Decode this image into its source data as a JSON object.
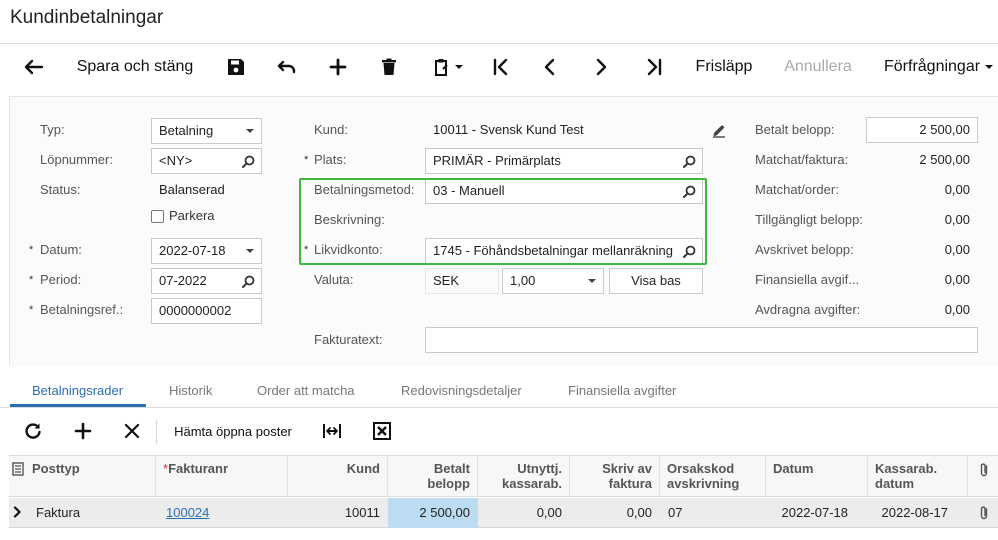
{
  "page": {
    "title": "Kundinbetalningar"
  },
  "toolbar": {
    "save_close": "Spara och stäng",
    "release": "Frisläpp",
    "cancel": "Annullera",
    "inquiries": "Förfrågningar"
  },
  "form": {
    "typ_label": "Typ:",
    "typ_value": "Betalning",
    "lopnummer_label": "Löpnummer:",
    "lopnummer_value": "<NY>",
    "status_label": "Status:",
    "status_value": "Balanserad",
    "parkera_label": "Parkera",
    "datum_label": "Datum:",
    "datum_value": "2022-07-18",
    "period_label": "Period:",
    "period_value": "07-2022",
    "betref_label": "Betalningsref.:",
    "betref_value": "0000000002",
    "kund_label": "Kund:",
    "kund_value": "10011 - Svensk Kund Test",
    "plats_label": "Plats:",
    "plats_value": "PRIMÄR - Primärplats",
    "betmetod_label": "Betalningsmetod:",
    "betmetod_value": "03 - Manuell",
    "beskrivning_label": "Beskrivning:",
    "likvid_label": "Likvidkonto:",
    "likvid_value": "1745 - Föhåndsbetalningar mellanräkning",
    "valuta_label": "Valuta:",
    "valuta_value": "SEK",
    "kurs_value": "1,00",
    "visa_bas": "Visa bas",
    "fakturatext_label": "Fakturatext:",
    "betalt_label": "Betalt belopp:",
    "betalt_value": "2 500,00",
    "matchfakt_label": "Matchat/faktura:",
    "matchfakt_value": "2 500,00",
    "matchorder_label": "Matchat/order:",
    "matchorder_value": "0,00",
    "tillg_label": "Tillgängligt belopp:",
    "tillg_value": "0,00",
    "avskr_label": "Avskrivet belopp:",
    "avskr_value": "0,00",
    "finavg_label": "Finansiella avgif...",
    "finavg_value": "0,00",
    "avdr_label": "Avdragna avgifter:",
    "avdr_value": "0,00"
  },
  "tabs": [
    "Betalningsrader",
    "Historik",
    "Order att matcha",
    "Redovisningsdetaljer",
    "Finansiella avgifter"
  ],
  "grid": {
    "fetch_open": "Hämta öppna poster",
    "headers": {
      "posttyp": "Posttyp",
      "fakturanr": "Fakturanr",
      "kund": "Kund",
      "betalt_1": "Betalt",
      "betalt_2": "belopp",
      "utnyttj_1": "Utnyttj.",
      "utnyttj_2": "kassarab.",
      "skriv_1": "Skriv av",
      "skriv_2": "faktura",
      "orsak_1": "Orsakskod",
      "orsak_2": "avskrivning",
      "datum": "Datum",
      "kassarab_1": "Kassarab.",
      "kassarab_2": "datum"
    },
    "row": {
      "posttyp": "Faktura",
      "fakturanr": "100024",
      "kund": "10011",
      "betalt": "2 500,00",
      "utnyttj": "0,00",
      "skriv": "0,00",
      "orsak": "07",
      "datum": "2022-07-18",
      "kassarab": "2022-08-17"
    }
  }
}
